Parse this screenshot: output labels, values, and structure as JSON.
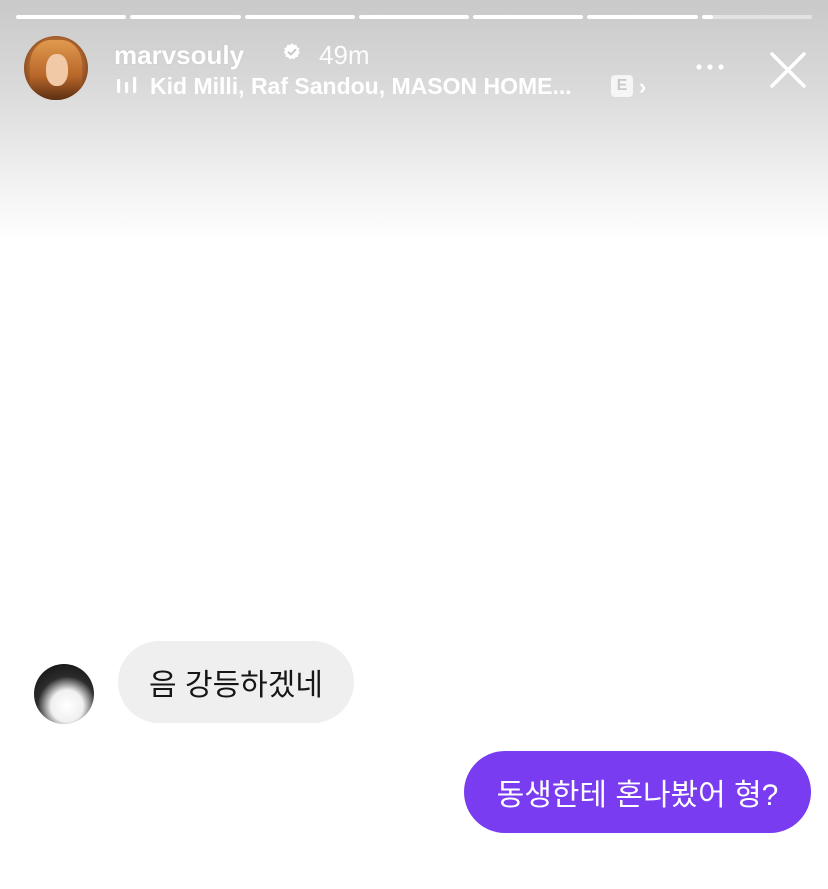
{
  "progress": {
    "segments": [
      1,
      1,
      1,
      1,
      1,
      1,
      0.1
    ]
  },
  "header": {
    "username": "marvsouly",
    "verified": true,
    "time_ago": "49m",
    "music": {
      "track_text": "Kid Milli, Raf Sandou, MASON HOME...",
      "explicit_label": "E",
      "chevron": "›"
    },
    "more_icon": "more-dots-icon",
    "close_icon": "close-icon"
  },
  "messages": [
    {
      "direction": "received",
      "text": "음 강등하겠네"
    },
    {
      "direction": "sent",
      "text": "동생한테 혼나봤어 형?"
    }
  ],
  "colors": {
    "sent_bubble": "#7a3cf0",
    "received_bubble": "#efefef",
    "verified_badge": "#ffffff"
  }
}
